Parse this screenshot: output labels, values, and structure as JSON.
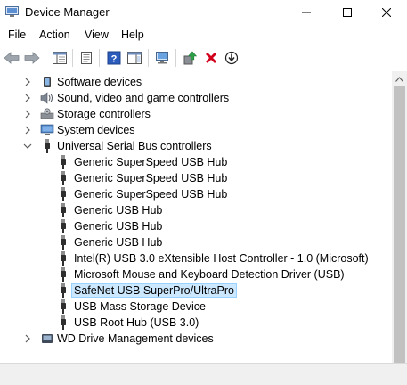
{
  "window": {
    "title": "Device Manager",
    "title_icon": "device-manager-icon"
  },
  "menu": [
    "File",
    "Action",
    "View",
    "Help"
  ],
  "toolbar": {
    "buttons": [
      "back-icon",
      "forward-icon",
      "show-hide-console-tree-icon",
      "properties-icon",
      "help-icon",
      "action-pane-icon",
      "scan-hardware-icon",
      "update-driver-icon",
      "uninstall-icon",
      "disable-icon"
    ]
  },
  "tree": {
    "rows": [
      {
        "label": "Software devices",
        "icon": "software-device-icon",
        "expander": "collapsed"
      },
      {
        "label": "Sound, video and game controllers",
        "icon": "speaker-icon",
        "expander": "collapsed"
      },
      {
        "label": "Storage controllers",
        "icon": "storage-controller-icon",
        "expander": "collapsed"
      },
      {
        "label": "System devices",
        "icon": "system-devices-icon",
        "expander": "collapsed"
      },
      {
        "label": "Universal Serial Bus controllers",
        "icon": "usb-icon",
        "expander": "expanded"
      },
      {
        "label": "Generic SuperSpeed USB Hub",
        "icon": "usb-icon"
      },
      {
        "label": "Generic SuperSpeed USB Hub",
        "icon": "usb-icon"
      },
      {
        "label": "Generic SuperSpeed USB Hub",
        "icon": "usb-icon"
      },
      {
        "label": "Generic USB Hub",
        "icon": "usb-icon"
      },
      {
        "label": "Generic USB Hub",
        "icon": "usb-icon"
      },
      {
        "label": "Generic USB Hub",
        "icon": "usb-icon"
      },
      {
        "label": "Intel(R) USB 3.0 eXtensible Host Controller - 1.0 (Microsoft)",
        "icon": "usb-icon"
      },
      {
        "label": "Microsoft Mouse and Keyboard Detection Driver (USB)",
        "icon": "usb-icon"
      },
      {
        "label": "SafeNet USB SuperPro/UltraPro",
        "icon": "usb-icon",
        "selected": true
      },
      {
        "label": "USB Mass Storage Device",
        "icon": "usb-icon"
      },
      {
        "label": "USB Root Hub (USB 3.0)",
        "icon": "usb-icon"
      },
      {
        "label": "WD Drive Management devices",
        "icon": "wd-device-icon",
        "expander": "collapsed"
      }
    ]
  },
  "colors": {
    "selection_bg": "#cce8ff",
    "selection_border": "#99d1ff",
    "uninstall_red": "#d3001b",
    "help_blue": "#2b5cbd"
  }
}
